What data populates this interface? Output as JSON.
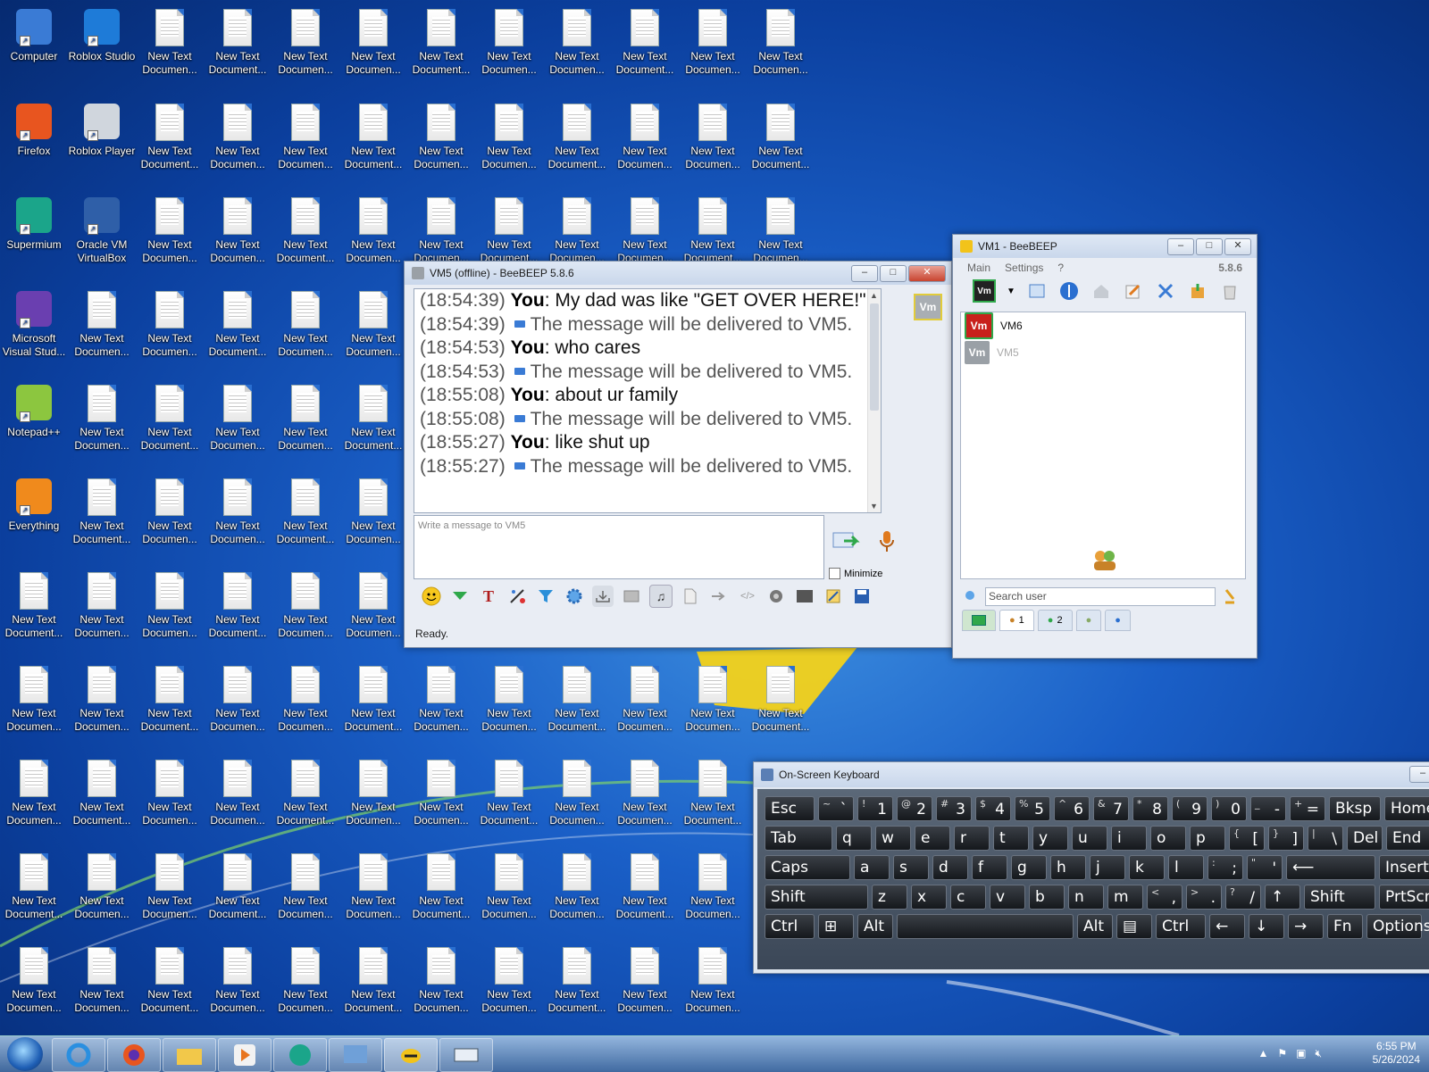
{
  "desktop_icons": [
    {
      "label": "Computer",
      "kind": "app",
      "color": "#3a7bd5"
    },
    {
      "label": "Roblox Studio",
      "kind": "app",
      "color": "#1e7bd8"
    },
    {
      "label": "Firefox",
      "kind": "app",
      "color": "#e8551f"
    },
    {
      "label": "Roblox Player",
      "kind": "app",
      "color": "#d0d6dd"
    },
    {
      "label": "Supermium",
      "kind": "app",
      "color": "#1ba58a"
    },
    {
      "label": "Oracle VM VirtualBox",
      "kind": "app",
      "color": "#2f5fa8"
    },
    {
      "label": "Microsoft Visual Stud...",
      "kind": "app",
      "color": "#6a3fb0"
    },
    {
      "label": "Notepad++",
      "kind": "app",
      "color": "#8cc63f"
    },
    {
      "label": "Everything",
      "kind": "app",
      "color": "#f08a1c"
    }
  ],
  "doc_labels": [
    "New Text Documen...",
    "New Text Document..."
  ],
  "chat_window": {
    "title": "VM5 (offline) - BeeBEEP 5.8.6",
    "messages": [
      {
        "ts": "(18:54:39)",
        "who": "You",
        "text": ": My dad was like \"GET OVER HERE!\""
      },
      {
        "ts": "(18:54:39)",
        "sys": "The message will be delivered to VM5."
      },
      {
        "ts": "(18:54:53)",
        "who": "You",
        "text": ": who cares"
      },
      {
        "ts": "(18:54:53)",
        "sys": "The message will be delivered to VM5."
      },
      {
        "ts": "(18:55:08)",
        "who": "You",
        "text": ": about ur family"
      },
      {
        "ts": "(18:55:08)",
        "sys": "The message will be delivered to VM5."
      },
      {
        "ts": "(18:55:27)",
        "who": "You",
        "text": ": like shut up"
      },
      {
        "ts": "(18:55:27)",
        "sys": "The message will be delivered to VM5."
      }
    ],
    "compose_placeholder": "Write a message to VM5",
    "minimize_label": "Minimize",
    "status": "Ready.",
    "avatar_badge": "Vm"
  },
  "main_window": {
    "title": "VM1 - BeeBEEP",
    "menu": [
      "Main",
      "Settings",
      "?"
    ],
    "version": "5.8.6",
    "users": [
      {
        "badge": "Vm",
        "name": "VM6",
        "online": true,
        "color": "#c8201c"
      },
      {
        "badge": "Vm",
        "name": "VM5",
        "online": false,
        "color": "#9aa0a6"
      }
    ],
    "search_placeholder": "Search user",
    "tabs": [
      "1",
      "2"
    ],
    "my_badge": "Vm"
  },
  "keyboard": {
    "title": "On-Screen Keyboard",
    "rows": [
      [
        "Esc",
        "~ `",
        "! 1",
        "@ 2",
        "# 3",
        "$ 4",
        "% 5",
        "^ 6",
        "& 7",
        "* 8",
        "( 9",
        ") 0",
        "_ -",
        "+ =",
        "Bksp",
        "Home"
      ],
      [
        "Tab",
        "q",
        "w",
        "e",
        "r",
        "t",
        "y",
        "u",
        "i",
        "o",
        "p",
        "{ [",
        "} ]",
        "| \\",
        "Del",
        "End"
      ],
      [
        "Caps",
        "a",
        "s",
        "d",
        "f",
        "g",
        "h",
        "j",
        "k",
        "l",
        ": ;",
        "\" '",
        "⟵",
        "Insert"
      ],
      [
        "Shift",
        "z",
        "x",
        "c",
        "v",
        "b",
        "n",
        "m",
        "< ,",
        "> .",
        "? /",
        "↑",
        "Shift",
        "PrtScn"
      ],
      [
        "Ctrl",
        "⊞",
        "Alt",
        "",
        "Alt",
        "▤",
        "Ctrl",
        "←",
        "↓",
        "→",
        "Fn",
        "Options"
      ]
    ]
  },
  "taskbar": {
    "time": "6:55 PM",
    "date": "5/26/2024"
  }
}
